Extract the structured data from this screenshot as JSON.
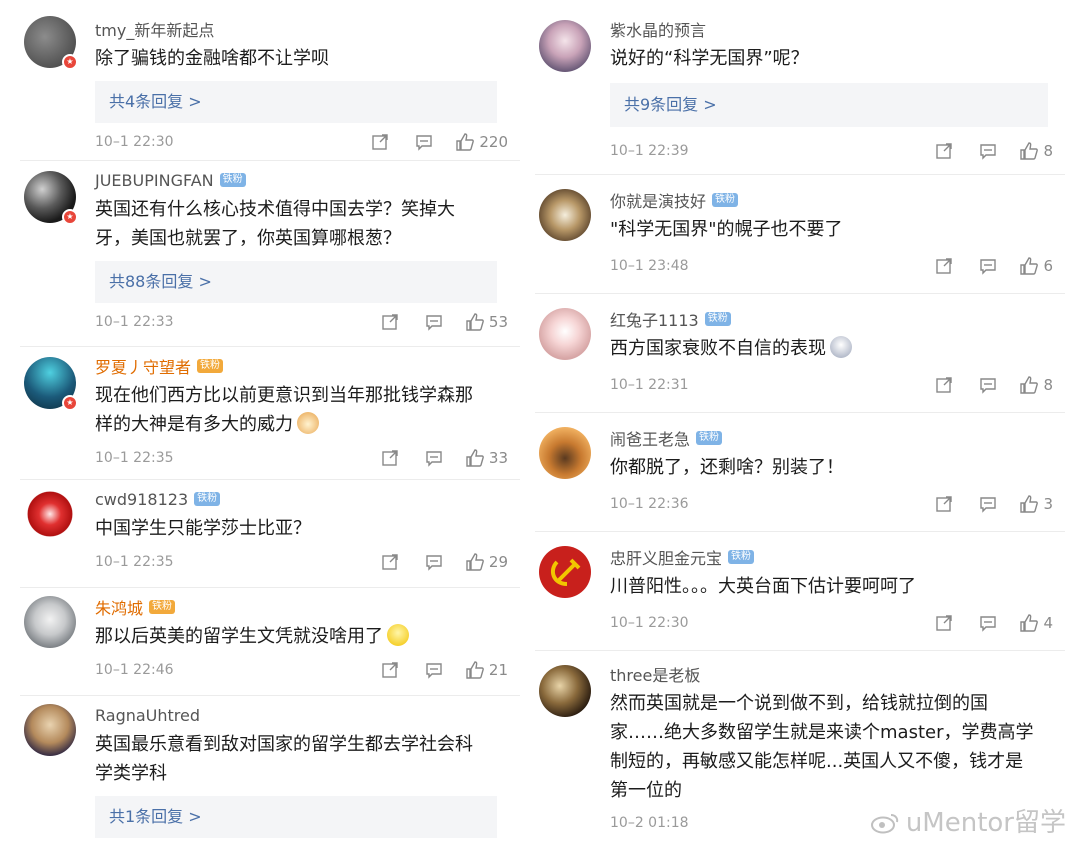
{
  "left_comments": [
    {
      "username": "tmy_新年新起点",
      "badge": "",
      "text": "除了骗钱的金融啥都不让学呗",
      "replies": "共4条回复 >",
      "time": "10–1 22:30",
      "likes": "220"
    },
    {
      "username": "JUEBUPINGFAN",
      "badge": "铁粉",
      "text": "英国还有什么核心技术值得中国去学？笑掉大牙，美国也就罢了，你英国算哪根葱？",
      "replies": "共88条回复 >",
      "time": "10–1 22:33",
      "likes": "53"
    },
    {
      "username": "罗夏丿守望者",
      "badge": "铁粉",
      "text": "现在他们西方比以前更意识到当年那批钱学森那样的大神是有多大的威力",
      "replies": "",
      "time": "10–1 22:35",
      "likes": "33"
    },
    {
      "username": "cwd918123",
      "badge": "铁粉",
      "text": "中国学生只能学莎士比亚？",
      "replies": "",
      "time": "10–1 22:35",
      "likes": "29"
    },
    {
      "username": "朱鸿城",
      "badge": "铁粉",
      "text": "那以后英美的留学生文凭就没啥用了",
      "replies": "",
      "time": "10–1 22:46",
      "likes": "21"
    },
    {
      "username": "RagnaUhtred",
      "badge": "",
      "text": "英国最乐意看到敌对国家的留学生都去学社会科学类学科",
      "replies": "共1条回复 >",
      "time": "",
      "likes": ""
    }
  ],
  "right_comments": [
    {
      "username": "紫水晶的预言",
      "badge": "",
      "text": "说好的“科学无国界”呢？",
      "replies": "共9条回复 >",
      "time": "10–1 22:39",
      "likes": "8"
    },
    {
      "username": "你就是演技好",
      "badge": "铁粉",
      "text": "\"科学无国界\"的幌子也不要了",
      "replies": "",
      "time": "10–1 23:48",
      "likes": "6"
    },
    {
      "username": "红兔子1113",
      "badge": "铁粉",
      "text": "西方国家衰败不自信的表现",
      "replies": "",
      "time": "10–1 22:31",
      "likes": "8"
    },
    {
      "username": "闹爸王老急",
      "badge": "铁粉",
      "text": "你都脱了，还剩啥？别装了！",
      "replies": "",
      "time": "10–1 22:36",
      "likes": "3"
    },
    {
      "username": "忠肝义胆金元宝",
      "badge": "铁粉",
      "text": "川普阳性。。。大英台面下估计要呵呵了",
      "replies": "",
      "time": "10–1 22:30",
      "likes": "4"
    },
    {
      "username": "three是老板",
      "badge": "",
      "text": "然而英国就是一个说到做不到，给钱就拉倒的国家……绝大多数留学生就是来读个master，学费高学制短的，再敏感又能怎样呢...英国人又不傻，钱才是第一位的",
      "replies": "",
      "time": "10–2 01:18",
      "likes": ""
    }
  ],
  "watermark": "uMentor留学",
  "colors": {
    "link": "#4a70a8",
    "time": "#9a9a9a",
    "reply_bg": "#f4f5f7"
  }
}
